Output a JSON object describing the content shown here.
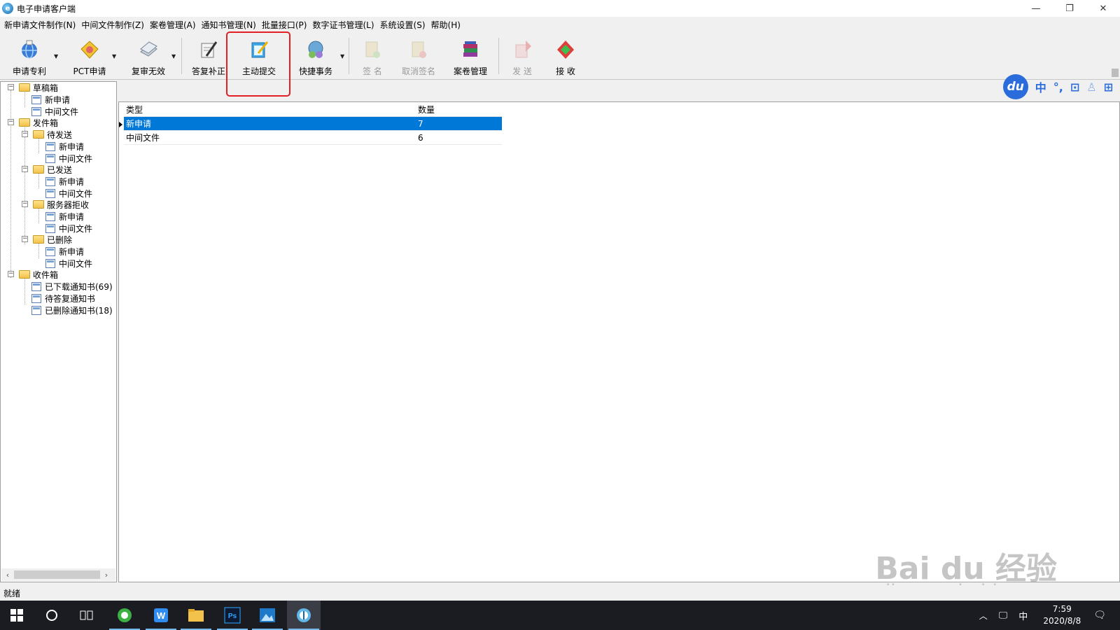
{
  "window": {
    "title": "电子申请客户端",
    "minimize_glyph": "—",
    "restore_glyph": "❐",
    "close_glyph": "✕"
  },
  "menu": [
    "新申请文件制作(N)",
    "中间文件制作(Z)",
    "案卷管理(A)",
    "通知书管理(N)",
    "批量接口(P)",
    "数字证书管理(L)",
    "系统设置(S)",
    "帮助(H)"
  ],
  "toolbar": {
    "apply_patent": "申请专利",
    "pct_apply": "PCT申请",
    "review_invalid": "复审无效",
    "reply_correct": "答复补正",
    "active_submit": "主动提交",
    "quick_affairs": "快捷事务",
    "sign": "签 名",
    "cancel_sign": "取消签名",
    "case_manage": "案卷管理",
    "send": "发 送",
    "receive": "接 收"
  },
  "ime": {
    "logo": "du",
    "lang": "中",
    "punct": "°,",
    "screen": "⊡",
    "user": "♙",
    "grid": "⊞"
  },
  "tree": {
    "drafts": "草稿箱",
    "drafts_new": "新申请",
    "drafts_mid": "中间文件",
    "outbox": "发件箱",
    "pending": "待发送",
    "pending_new": "新申请",
    "pending_mid": "中间文件",
    "sent": "已发送",
    "sent_new": "新申请",
    "sent_mid": "中间文件",
    "rejected": "服务器拒收",
    "rejected_new": "新申请",
    "rejected_mid": "中间文件",
    "deleted": "已删除",
    "deleted_new": "新申请",
    "deleted_mid": "中间文件",
    "inbox": "收件箱",
    "downloaded": "已下载通知书(69)",
    "to_reply": "待答复通知书",
    "deleted_notice": "已删除通知书(18)"
  },
  "grid": {
    "col_type": "类型",
    "col_count": "数量",
    "rows": [
      {
        "type": "新申请",
        "count": "7"
      },
      {
        "type": "中间文件",
        "count": "6"
      }
    ]
  },
  "status": "就绪",
  "taskbar": {
    "time": "7:59",
    "date": "2020/8/8",
    "ime_lang": "中"
  },
  "watermark": {
    "main": "Bai du 经验",
    "sub": "jingyan.baidu.com"
  }
}
